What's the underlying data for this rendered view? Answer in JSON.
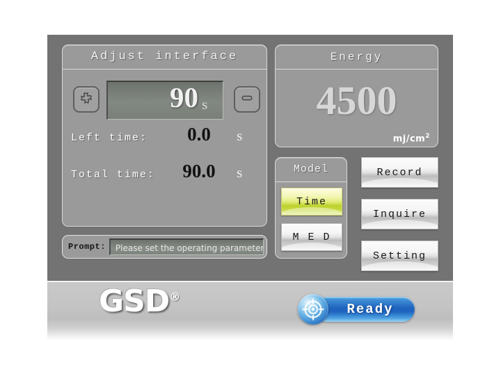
{
  "adjust": {
    "title": "Adjust interface",
    "increase_icon": "plus-icon",
    "decrease_icon": "minus-icon",
    "value": "90",
    "value_unit": "S",
    "left_time_label": "Left time:",
    "left_time_value": "0.0",
    "left_time_unit": "S",
    "total_time_label": "Total time:",
    "total_time_value": "90.0",
    "total_time_unit": "S"
  },
  "prompt": {
    "label": "Prompt:",
    "message": "Please set the operating parameters"
  },
  "energy": {
    "title": "Energy",
    "value": "4500",
    "unit_base": "mj/cm",
    "unit_exp": "2"
  },
  "model": {
    "title": "Model",
    "options": [
      {
        "label": "Time",
        "selected": true
      },
      {
        "label": "M E D",
        "selected": false
      }
    ]
  },
  "actions": [
    {
      "label": "Record"
    },
    {
      "label": "Inquire"
    },
    {
      "label": "Setting"
    }
  ],
  "footer": {
    "brand": "GSD",
    "brand_mark": "®",
    "status_label": "Ready",
    "status_icon": "crosshair-target-icon"
  },
  "colors": {
    "frame": "#737373",
    "panel": "#9a9a9a",
    "panel_border": "#d8d8d8",
    "display_bg": "#7b817b",
    "selected_button": "#bcd22c",
    "status_blue": "#1e63bd",
    "bottom_bar": "#c3c3c3"
  }
}
